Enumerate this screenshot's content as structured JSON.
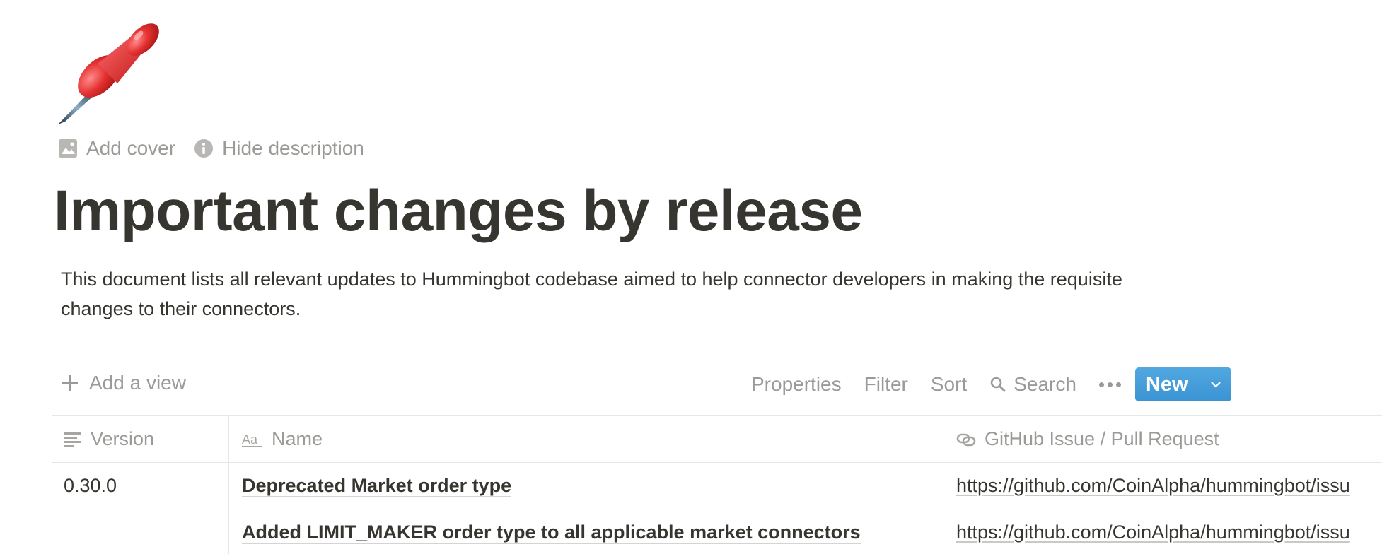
{
  "page": {
    "icon": "pushpin-emoji",
    "controls": {
      "add_cover": "Add cover",
      "hide_description": "Hide description"
    },
    "title": "Important changes by release",
    "description": "This document lists all relevant updates to Hummingbot codebase aimed to help connector developers in making the requisite changes to their connectors."
  },
  "toolbar": {
    "add_view": "Add a view",
    "properties": "Properties",
    "filter": "Filter",
    "sort": "Sort",
    "search": "Search",
    "new_label": "New"
  },
  "table": {
    "columns": [
      {
        "label": "Version",
        "icon": "text-lines-icon"
      },
      {
        "label": "Name",
        "icon": "title-aa-icon"
      },
      {
        "label": "GitHub Issue / Pull Request",
        "icon": "url-link-icon"
      }
    ],
    "rows": [
      {
        "version": "0.30.0",
        "name": "Deprecated Market order type",
        "github": "https://github.com/CoinAlpha/hummingbot/issu"
      },
      {
        "version": "",
        "name": "Added LIMIT_MAKER order type to all applicable market connectors",
        "github": "https://github.com/CoinAlpha/hummingbot/issu"
      }
    ]
  },
  "colors": {
    "text": "#37352f",
    "muted": "#9b9a97",
    "accent": "#2f8ccf",
    "pin": "#e33b3b"
  }
}
